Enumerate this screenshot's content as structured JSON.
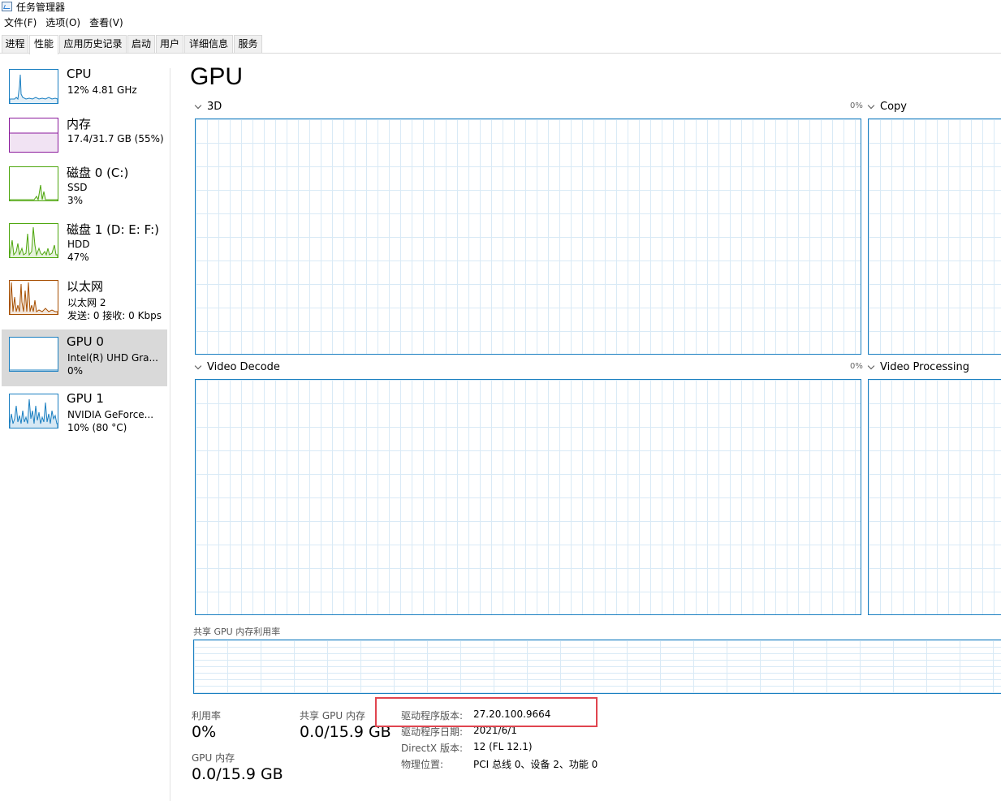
{
  "window": {
    "title": "任务管理器",
    "icon": "task-manager-icon"
  },
  "menu": [
    "文件(F)",
    "选项(O)",
    "查看(V)"
  ],
  "tabs": [
    {
      "label": "进程",
      "active": false
    },
    {
      "label": "性能",
      "active": true
    },
    {
      "label": "应用历史记录",
      "active": false
    },
    {
      "label": "启动",
      "active": false
    },
    {
      "label": "用户",
      "active": false
    },
    {
      "label": "详细信息",
      "active": false
    },
    {
      "label": "服务",
      "active": false
    }
  ],
  "sidebar": [
    {
      "name": "CPU",
      "line1": "12%  4.81 GHz",
      "line2": "",
      "color": "#1a7fc1",
      "selected": false
    },
    {
      "name": "内存",
      "line1": "17.4/31.7 GB (55%)",
      "line2": "",
      "color": "#8b1a9c",
      "selected": false
    },
    {
      "name": "磁盘 0 (C:)",
      "line1": "SSD",
      "line2": "3%",
      "color": "#4da60c",
      "selected": false
    },
    {
      "name": "磁盘 1 (D: E: F:)",
      "line1": "HDD",
      "line2": "47%",
      "color": "#4da60c",
      "selected": false
    },
    {
      "name": "以太网",
      "line1": "以太网 2",
      "line2": "发送: 0  接收: 0 Kbps",
      "color": "#a74f01",
      "selected": false
    },
    {
      "name": "GPU 0",
      "line1": "Intel(R) UHD Gra...",
      "line2": "0%",
      "color": "#1a7fc1",
      "selected": true
    },
    {
      "name": "GPU 1",
      "line1": "NVIDIA GeForce...",
      "line2": "10% (80 °C)",
      "color": "#1a7fc1",
      "selected": false
    }
  ],
  "main": {
    "title": "GPU",
    "graphs": [
      {
        "label": "3D",
        "pct": "0%"
      },
      {
        "label": "Copy",
        "pct": ""
      },
      {
        "label": "Video Decode",
        "pct": "0%"
      },
      {
        "label": "Video Processing",
        "pct": ""
      }
    ],
    "shared_mem_label": "共享 GPU 内存利用率"
  },
  "stats": {
    "util_label": "利用率",
    "util_value": "0%",
    "shared_label": "共享 GPU 内存",
    "shared_value": "0.0/15.9 GB",
    "gpu_mem_label": "GPU 内存",
    "gpu_mem_value": "0.0/15.9 GB"
  },
  "info": [
    {
      "key": "驱动程序版本:",
      "value": "27.20.100.9664"
    },
    {
      "key": "驱动程序日期:",
      "value": "2021/6/1"
    },
    {
      "key": "DirectX 版本:",
      "value": "12 (FL 12.1)"
    },
    {
      "key": "物理位置:",
      "value": "PCI 总线 0、设备 2、功能 0"
    }
  ],
  "highlight_color": "#e0454f"
}
